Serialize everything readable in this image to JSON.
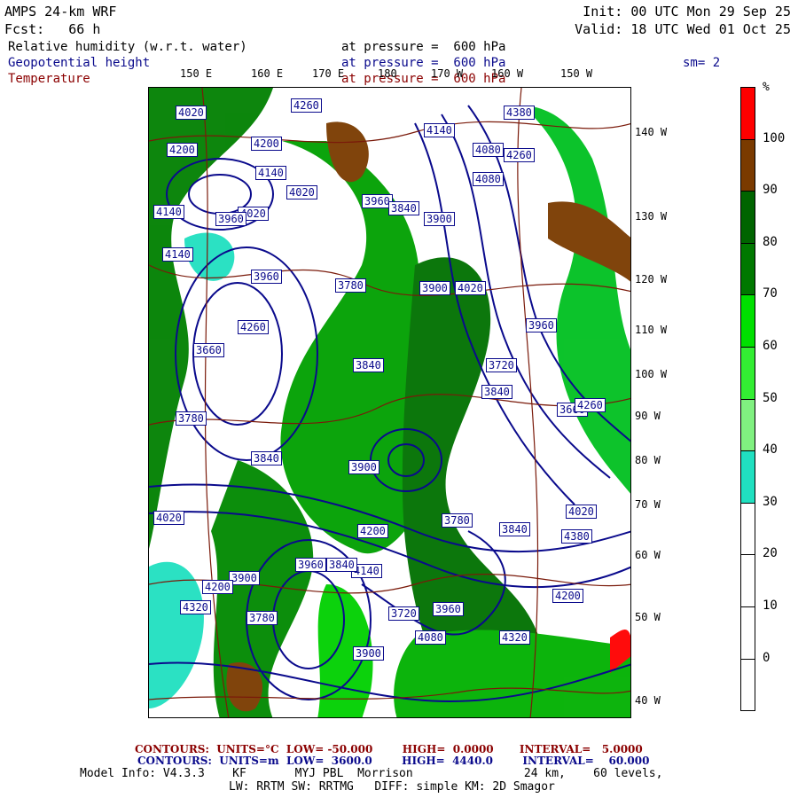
{
  "header": {
    "model": "AMPS 24-km WRF",
    "fcst": "Fcst:   66 h",
    "init": "Init: 00 UTC Mon 29 Sep 25",
    "valid": "Valid: 18 UTC Wed 01 Oct 25",
    "fields": [
      {
        "name": "Relative humidity (w.r.t. water)",
        "level": "at pressure =  600 hPa"
      },
      {
        "name": "Geopotential height",
        "level": "at pressure =  600 hPa"
      },
      {
        "name": "Temperature",
        "level": "at pressure =  600 hPa"
      }
    ],
    "smoothing": "sm= 2"
  },
  "map": {
    "lon_labels": [
      "150 E",
      "160 E",
      "170 E",
      "180",
      "170 W",
      "160 W",
      "150 W"
    ],
    "lat_labels": [
      "140 W",
      "130 W",
      "120 W",
      "110 W",
      "100 W",
      "90 W",
      "80 W",
      "70 W",
      "60 W",
      "50 W",
      "40 W"
    ],
    "height_labels": [
      "4020",
      "4260",
      "4380",
      "4140",
      "4200",
      "4200",
      "4080",
      "4020",
      "4080",
      "4260",
      "4140",
      "4020",
      "3960",
      "3900",
      "3960",
      "4140",
      "4140",
      "3960",
      "3840",
      "3780",
      "3900",
      "4020",
      "3720",
      "3840",
      "3960",
      "3660",
      "3840",
      "3660",
      "3780",
      "3840",
      "3900",
      "4020",
      "4200",
      "4020",
      "3780",
      "3840",
      "3900",
      "3960",
      "4200",
      "4320",
      "4140",
      "3960",
      "3900",
      "4260",
      "4200",
      "4080",
      "4320",
      "4380",
      "4260",
      "3840",
      "3780",
      "3720"
    ],
    "colors": {
      "background": "#ffffff",
      "height_contour": "#0a0a8c",
      "temp_contour": "#7a1a0a"
    }
  },
  "colorbar": {
    "unit": "%",
    "labels": [
      "100",
      "90",
      "80",
      "70",
      "60",
      "50",
      "40",
      "30",
      "20",
      "10",
      "0"
    ],
    "colors": [
      "#ff0000",
      "#7a3a00",
      "#006400",
      "#007800",
      "#00e000",
      "#33ee33",
      "#80f080",
      "#20e0c0",
      "#ffffff",
      "#ffffff",
      "#ffffff",
      "#ffffff"
    ]
  },
  "footer": {
    "temp_contours": "CONTOURS:  UNITS=°C  LOW= -50.000        HIGH=  0.0000       INTERVAL=   5.0000",
    "height_contours": "CONTOURS:  UNITS=m  LOW=  3600.0        HIGH=  4440.0        INTERVAL=    60.000",
    "model_info": "Model Info: V4.3.3    KF       MYJ PBL  Morrison                24 km,    60 levels,",
    "model_info2": "LW: RRTM SW: RRTMG   DIFF: simple KM: 2D Smagor"
  }
}
